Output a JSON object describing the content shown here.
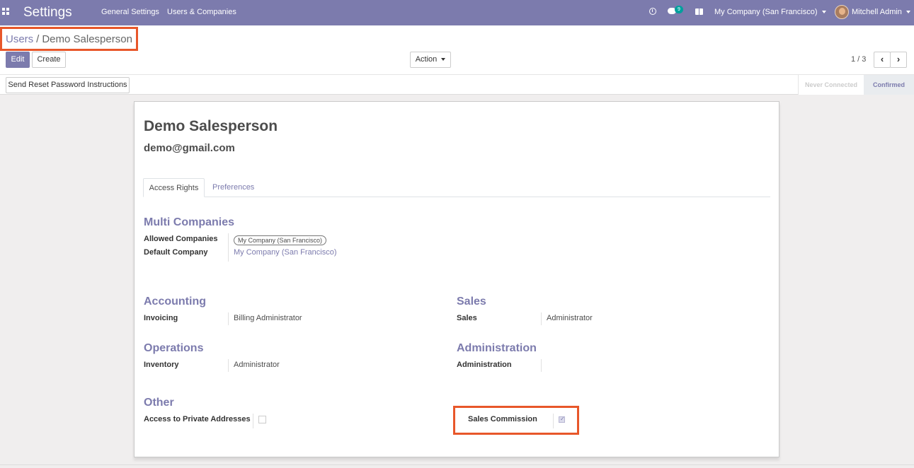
{
  "navbar": {
    "app_title": "Settings",
    "menu": [
      "General Settings",
      "Users & Companies"
    ],
    "chat_count": "9",
    "company": "My Company (San Francisco)",
    "user": "Mitchell Admin",
    "bg_color": "#7c7bad"
  },
  "breadcrumb": {
    "parent": "Users",
    "separator": "/",
    "current": "Demo Salesperson"
  },
  "buttons": {
    "edit": "Edit",
    "create": "Create",
    "action": "Action",
    "reset_password": "Send Reset Password Instructions"
  },
  "pager": {
    "text": "1 / 3",
    "prev_icon": "chevron-left",
    "next_icon": "chevron-right"
  },
  "status": {
    "steps": [
      "Never Connected",
      "Confirmed"
    ],
    "active": "Confirmed"
  },
  "record": {
    "name": "Demo Salesperson",
    "email": "demo@gmail.com"
  },
  "tabs": [
    "Access Rights",
    "Preferences"
  ],
  "active_tab": "Access Rights",
  "groups": {
    "multi_companies": {
      "title": "Multi Companies",
      "allowed_label": "Allowed Companies",
      "allowed_value": "My Company (San Francisco)",
      "default_label": "Default Company",
      "default_value": "My Company (San Francisco)"
    },
    "accounting": {
      "title": "Accounting",
      "field_label": "Invoicing",
      "field_value": "Billing Administrator"
    },
    "sales": {
      "title": "Sales",
      "field_label": "Sales",
      "field_value": "Administrator"
    },
    "operations": {
      "title": "Operations",
      "field_label": "Inventory",
      "field_value": "Administrator"
    },
    "administration": {
      "title": "Administration",
      "field_label": "Administration",
      "field_value": ""
    },
    "other": {
      "title": "Other",
      "field_label": "Access to Private Addresses",
      "field_checked": false
    },
    "sales_commission": {
      "field_label": "Sales Commission",
      "field_checked": true
    }
  },
  "colors": {
    "accent": "#7c7bad",
    "highlight": "#e8572a",
    "badge": "#00a09d"
  }
}
